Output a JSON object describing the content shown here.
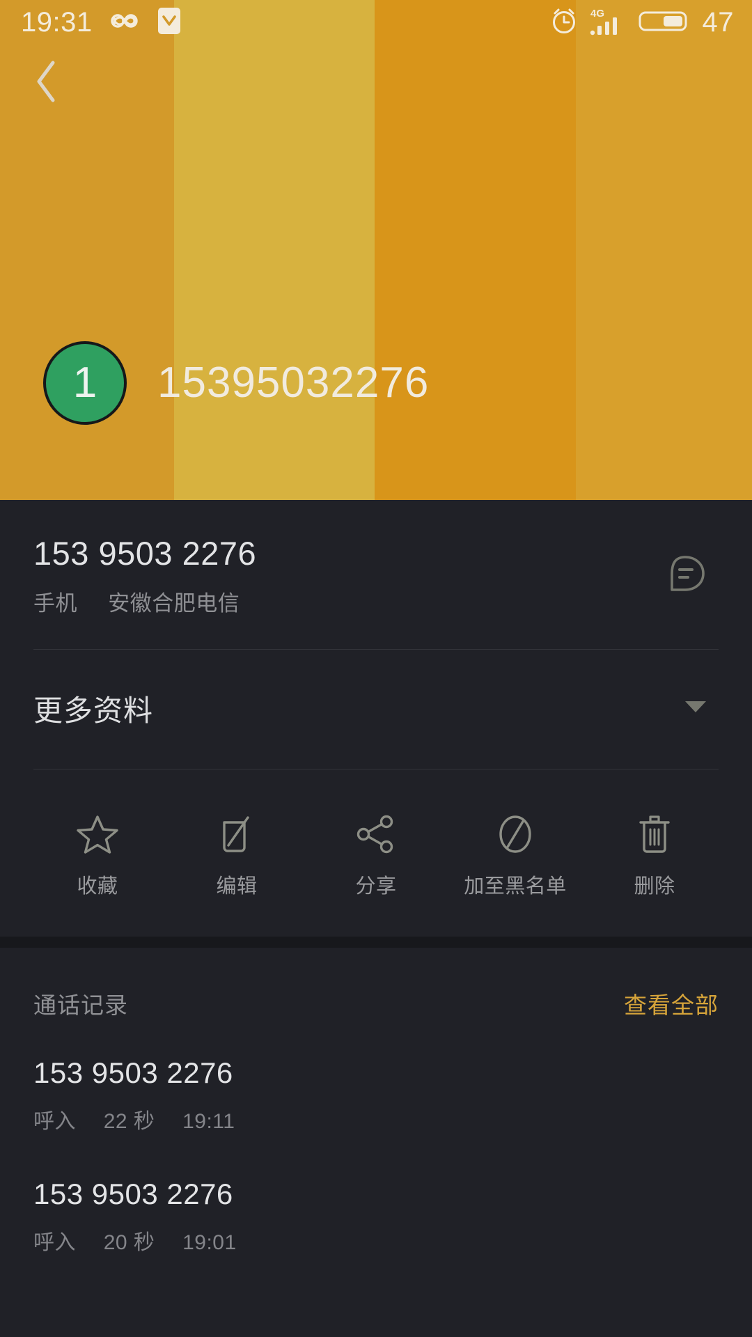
{
  "statusbar": {
    "time": "19:31",
    "battery_percent": "47",
    "network_type": "4G",
    "icons": {
      "infinity": "infinity-icon",
      "download": "download-badge-icon",
      "alarm": "alarm-clock-icon",
      "signal": "signal-bars-icon",
      "battery": "battery-icon"
    }
  },
  "header": {
    "back_icon": "back-chevron-icon",
    "avatar_initial": "1",
    "avatar_color": "#2fa060",
    "hero_number": "15395032276",
    "band_colors": [
      "#d39a2a",
      "#d7b23f",
      "#d8951a",
      "#d8a02c"
    ]
  },
  "contact": {
    "phone_number": "153 9503 2276",
    "type_label": "手机",
    "carrier": "安徽合肥电信",
    "message_icon": "message-bubble-icon"
  },
  "more_info": {
    "label": "更多资料",
    "caret_icon": "chevron-down-icon"
  },
  "actions": [
    {
      "label": "收藏",
      "icon": "star-icon"
    },
    {
      "label": "编辑",
      "icon": "edit-pencil-icon"
    },
    {
      "label": "分享",
      "icon": "share-icon"
    },
    {
      "label": "加至黑名单",
      "icon": "block-circle-icon"
    },
    {
      "label": "删除",
      "icon": "trash-icon"
    }
  ],
  "call_log": {
    "title": "通话记录",
    "view_all": "查看全部",
    "view_all_color": "#d6a43a",
    "entries": [
      {
        "number": "153 9503 2276",
        "direction": "呼入",
        "duration": "22 秒",
        "time": "19:11"
      },
      {
        "number": "153 9503 2276",
        "direction": "呼入",
        "duration": "20 秒",
        "time": "19:01"
      }
    ]
  }
}
